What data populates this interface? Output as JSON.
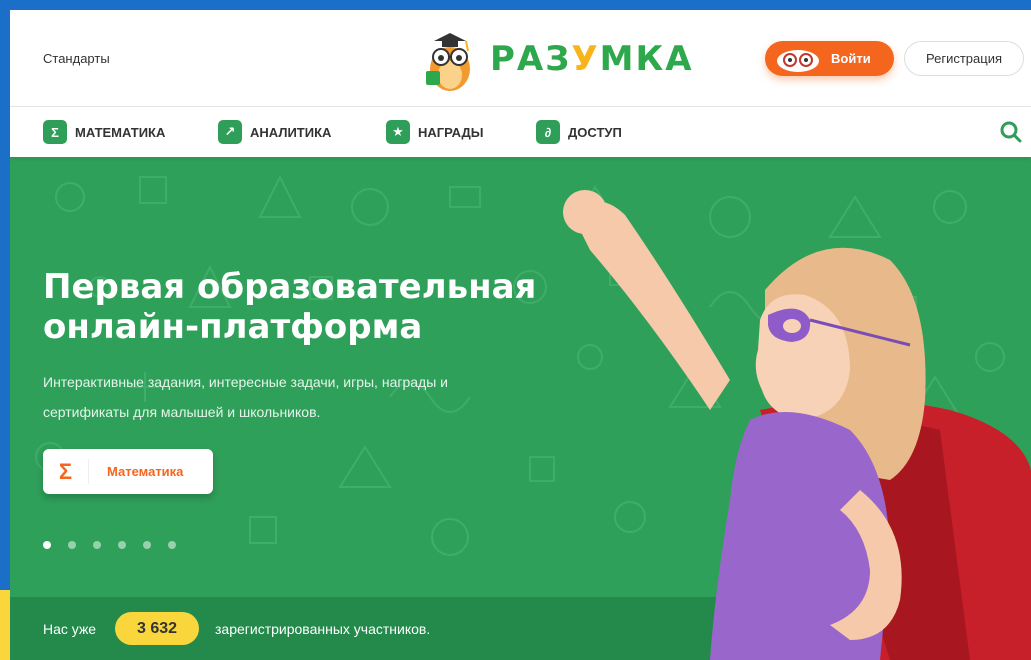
{
  "header": {
    "standards_link": "Стандарты",
    "logo_text_start": "РАЗ",
    "logo_text_y": "У",
    "logo_text_end": "МКА",
    "login_label": "Войти",
    "register_label": "Регистрация"
  },
  "nav": {
    "items": [
      {
        "label": "МАТЕМАТИКА",
        "icon": "sigma-icon",
        "glyph": "Σ"
      },
      {
        "label": "АНАЛИТИКА",
        "icon": "chart-icon",
        "glyph": "↗"
      },
      {
        "label": "НАГРАДЫ",
        "icon": "star-icon",
        "glyph": "★"
      },
      {
        "label": "ДОСТУП",
        "icon": "access-icon",
        "glyph": "∂"
      }
    ]
  },
  "hero": {
    "title_line1": "Первая образовательная",
    "title_line2": "онлайн-платформа",
    "subtitle_line1": "Интерактивные задания, интересные задачи, игры, награды и",
    "subtitle_line2": "сертификаты для малышей и школьников.",
    "subject_glyph": "Σ",
    "subject_label": "Математика",
    "slides": 6,
    "active_slide": 0
  },
  "stats": {
    "prefix": "Нас уже",
    "count": "3 632",
    "suffix": "зарегистрированных участников."
  },
  "colors": {
    "brand_green": "#2fa05a",
    "accent_orange": "#f4661e",
    "badge_yellow": "#f9d73c",
    "frame_blue": "#1c6fc9"
  }
}
